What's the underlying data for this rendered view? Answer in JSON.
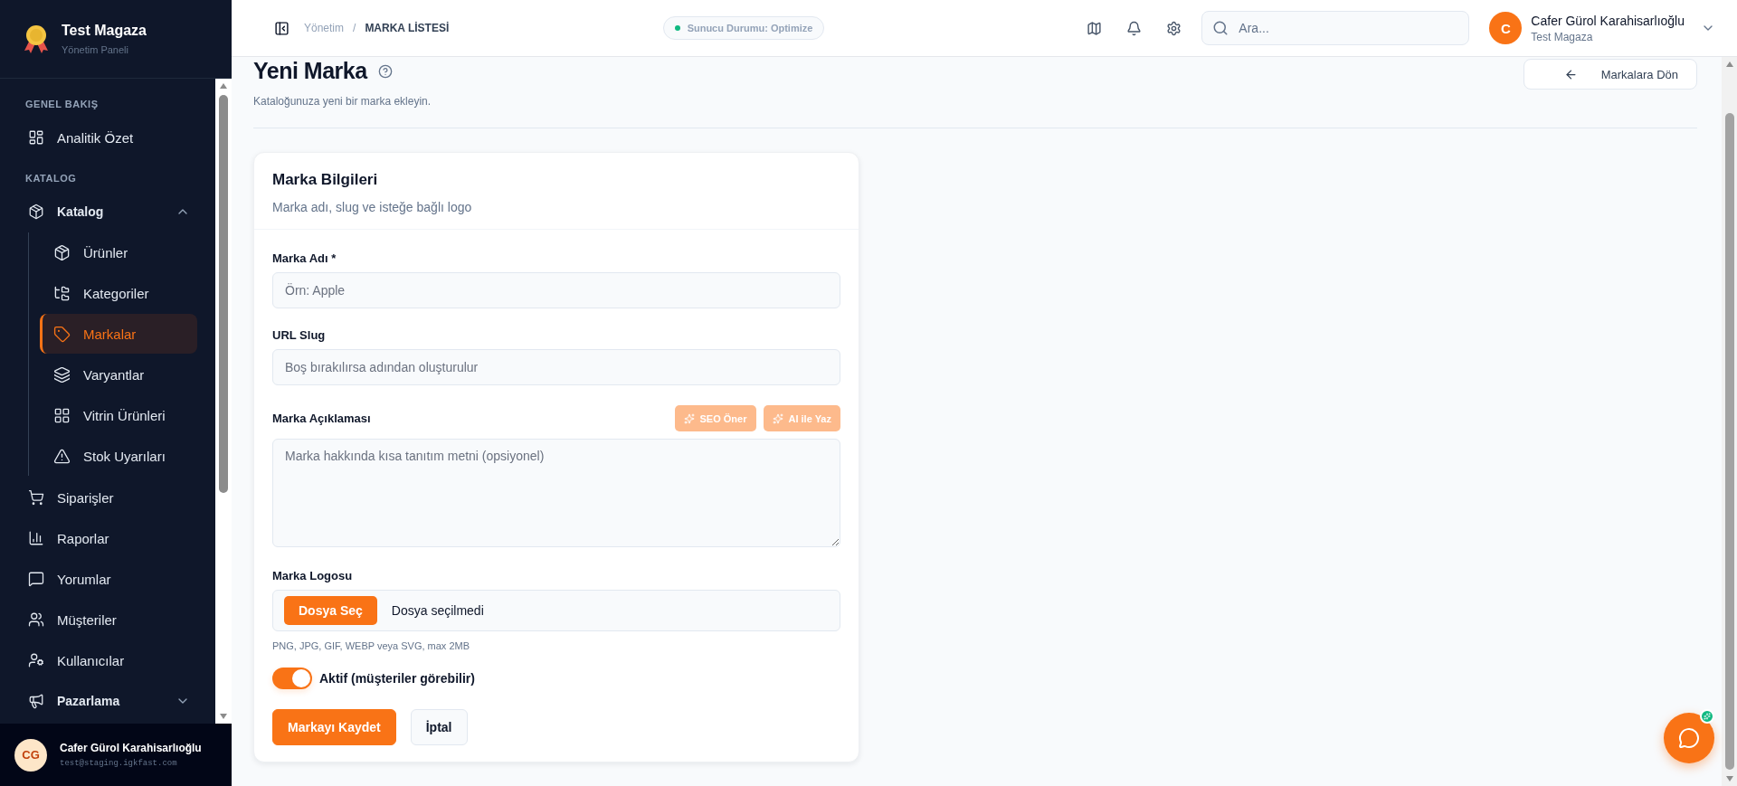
{
  "sidebar": {
    "brand": {
      "title": "Test Magaza",
      "subtitle": "Yönetim Paneli"
    },
    "sections": [
      {
        "heading": "GENEL BAKIŞ",
        "items": [
          {
            "label": "Analitik Özet",
            "selected": false
          }
        ]
      },
      {
        "heading": "KATALOG",
        "items": [
          {
            "label": "Katalog",
            "selected": false,
            "expanded": true,
            "children": [
              {
                "label": "Ürünler",
                "selected": false
              },
              {
                "label": "Kategoriler",
                "selected": false
              },
              {
                "label": "Markalar",
                "selected": true
              },
              {
                "label": "Varyantlar",
                "selected": false
              },
              {
                "label": "Vitrin Ürünleri",
                "selected": false
              },
              {
                "label": "Stok Uyarıları",
                "selected": false
              }
            ]
          },
          {
            "label": "Siparişler",
            "selected": false
          },
          {
            "label": "Raporlar",
            "selected": false
          },
          {
            "label": "Yorumlar",
            "selected": false
          },
          {
            "label": "Müşteriler",
            "selected": false
          },
          {
            "label": "Kullanıcılar",
            "selected": false
          },
          {
            "label": "Pazarlama",
            "selected": false,
            "expanded": false
          }
        ]
      }
    ],
    "user": {
      "initials": "CG",
      "name": "Cafer Gürol Karahisarlıoğlu",
      "email": "test@staging.igkfast.com"
    }
  },
  "header": {
    "breadcrumb": [
      "Yönetim",
      "MARKA LİSTESİ"
    ],
    "separator": "/",
    "status": "Sunucu Durumu: Optimize",
    "search": {
      "placeholder": "Ara..."
    },
    "user": {
      "initial": "C",
      "name": "Cafer Gürol Karahisarlıoğlu",
      "store": "Test Magaza"
    }
  },
  "page": {
    "title": "Yeni Marka",
    "subtitle": "Kataloğunuza yeni bir marka ekleyin.",
    "back_button": "Markalara Dön"
  },
  "form": {
    "title": "Marka Bilgileri",
    "subtitle": "Marka adı, slug ve isteğe bağlı logo",
    "fields": [
      {
        "kind": "text",
        "label": "Marka Adı *",
        "placeholder": "Örn: Apple"
      },
      {
        "kind": "text",
        "label": "URL Slug",
        "placeholder": "Boş bırakılırsa adından oluşturulur"
      },
      {
        "kind": "textarea",
        "label": "Marka Açıklaması",
        "placeholder": "Marka hakkında kısa tanıtım metni (opsiyonel)",
        "actions": [
          {
            "label": "SEO Öner",
            "disabled": true
          },
          {
            "label": "AI ile Yaz",
            "disabled": true
          }
        ]
      },
      {
        "kind": "file",
        "label": "Marka Logosu",
        "button": "Dosya Seç",
        "value": "Dosya seçilmedi",
        "hint": "PNG, JPG, GIF, WEBP veya SVG, max 2MB"
      }
    ],
    "toggle": {
      "label": "Aktif (müşteriler görebilir)",
      "on": true
    },
    "buttons": [
      {
        "kind": "primary",
        "label": "Markayı Kaydet"
      },
      {
        "kind": "secondary",
        "label": "İptal"
      }
    ]
  }
}
